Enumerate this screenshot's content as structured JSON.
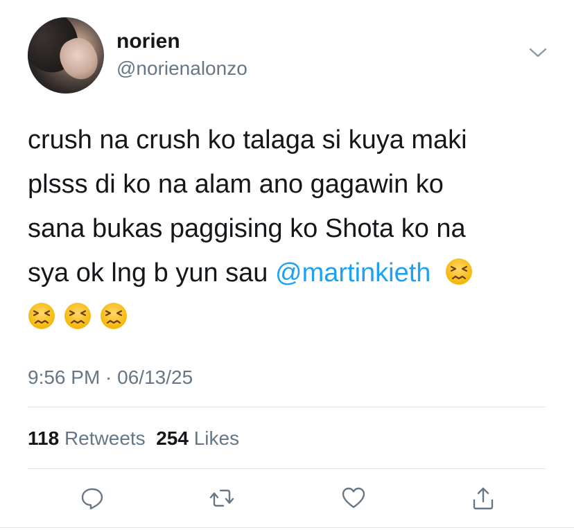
{
  "tweet": {
    "display_name": "norien",
    "handle": "@norienalonzo",
    "text_segments": {
      "line1": "crush na crush ko talaga si kuya maki",
      "line2": "plsss di ko na alam ano gagawin ko",
      "line3": "sana bukas paggising ko Shota ko na",
      "line4_prefix": "sya ok lng b yun sau ",
      "mention": "@martinkieth"
    },
    "emoji_icon": "persevering-face-emoji",
    "emoji_count": 4,
    "timestamp": "9:56 PM · 06/13/25",
    "retweets_count": "118",
    "retweets_label": "Retweets",
    "likes_count": "254",
    "likes_label": "Likes"
  },
  "icons": {
    "menu": "chevron-down-icon",
    "reply": "reply-icon",
    "retweet": "retweet-icon",
    "like": "heart-icon",
    "share": "share-icon"
  },
  "colors": {
    "text": "#14171a",
    "secondary": "#657786",
    "link": "#1da1f2",
    "divider": "#e1e8ed"
  }
}
